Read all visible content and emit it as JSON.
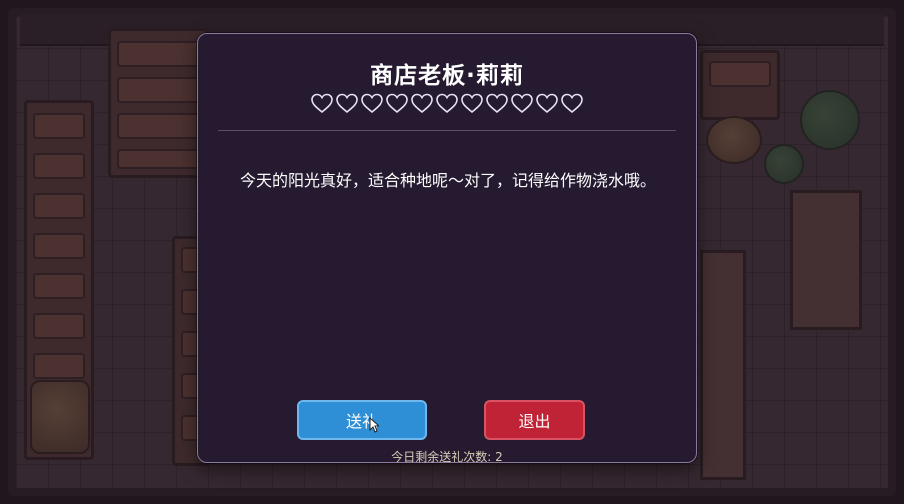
{
  "dialog": {
    "title": "商店老板·莉莉",
    "affection": {
      "filled": 0,
      "total": 11
    },
    "message": "今天的阳光真好，适合种地呢～对了，记得给作物浇水哦。",
    "gift_button_label": "送礼",
    "exit_button_label": "退出",
    "gift_remaining": "今日剩余送礼次数: 2"
  },
  "colors": {
    "dialog_bg": "#251a30",
    "gift_button": "#2e8fd6",
    "exit_button": "#bf2335",
    "heart_outline": "#e8dff0"
  },
  "icons": {
    "heart": "heart-outline-icon",
    "cursor": "pointer-cursor-icon"
  }
}
